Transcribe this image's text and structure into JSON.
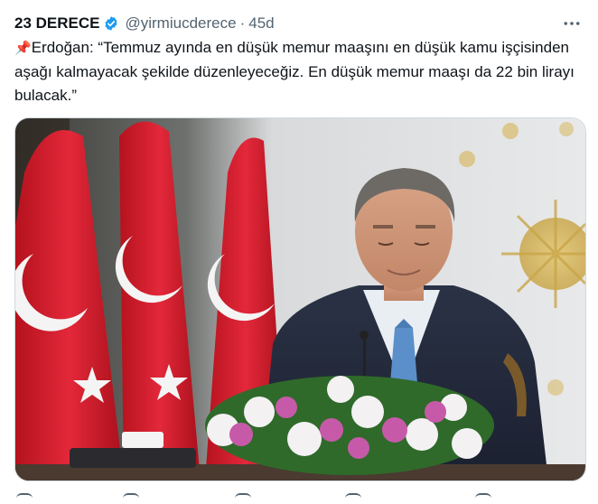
{
  "author": {
    "name": "23 DERECE",
    "handle": "@yirmiucderece",
    "separator": "·",
    "time": "45d"
  },
  "tweet": {
    "pin_emoji": "📌",
    "text": "Erdoğan: “Temmuz ayında en düşük memur maaşını en düşük kamu işçisinden aşağı kalmayacak şekilde düzenleyeceğiz. En düşük memur maaşı da 22 bin lirayı bulacak.”"
  },
  "icons": {
    "verified": "verified-badge-icon",
    "more": "more-dots-icon",
    "actions": [
      "reply-icon",
      "retweet-icon",
      "like-icon",
      "views-icon",
      "share-icon"
    ]
  },
  "colors": {
    "verified": "#1d9bf0",
    "secondary_text": "#536471",
    "flag_red": "#d81e2c"
  }
}
